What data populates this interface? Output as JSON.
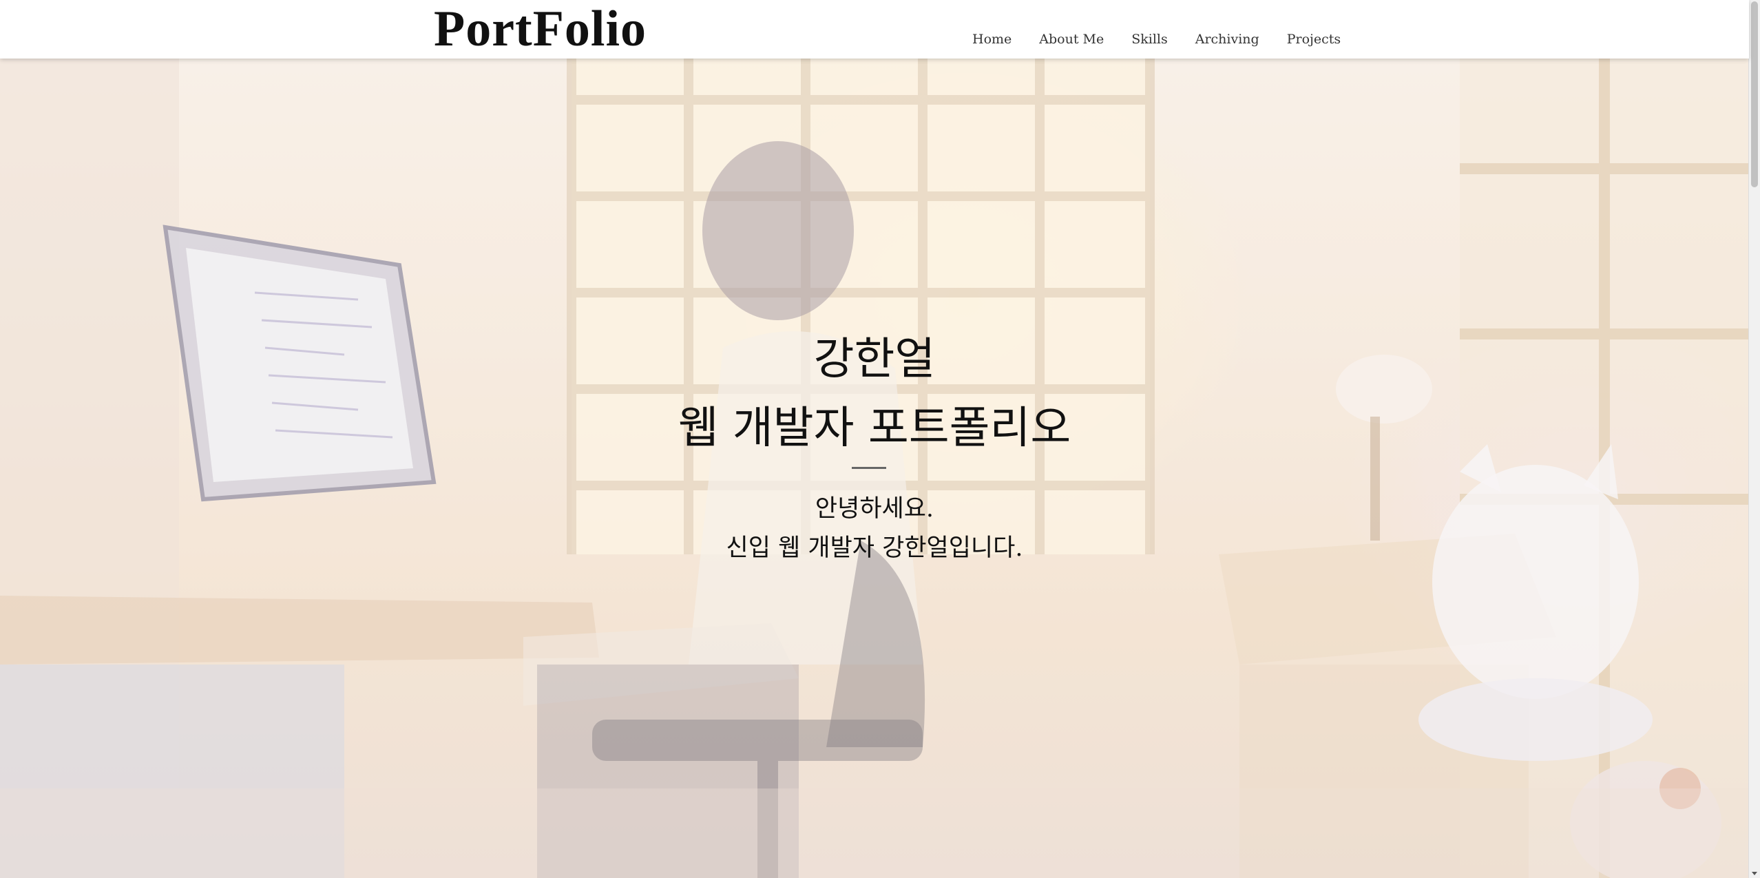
{
  "header": {
    "logo": "PortFolio",
    "nav": [
      "Home",
      "About Me",
      "Skills",
      "Archiving",
      "Projects"
    ]
  },
  "hero": {
    "name": "강한얼",
    "headline": "웹 개발자 포트폴리오",
    "greeting": "안녕하세요.",
    "intro": "신입 웹 개발자 강한얼입니다.",
    "background_image": "illustration of developer working at computer in sunlit room with cat plush"
  },
  "colors": {
    "header_bg": "#ffffff",
    "text": "#111111",
    "divider": "#666666"
  }
}
